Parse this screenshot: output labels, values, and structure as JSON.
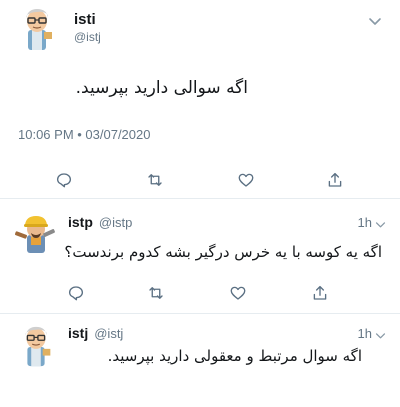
{
  "main_tweet": {
    "display_name": "isti",
    "handle": "@istj",
    "text": "اگه سوالی دارید بپرسید.",
    "timestamp": "10:06 PM • 03/07/2020",
    "avatar": "scientist-avatar",
    "actions": [
      "reply-icon",
      "retweet-icon",
      "like-icon",
      "share-icon"
    ]
  },
  "replies": [
    {
      "display_name": "istp",
      "handle": "@istp",
      "time_ago": "1h",
      "text": "اگه یه کوسه با یه خرس درگیر بشه کدوم برندست؟",
      "avatar": "builder-avatar"
    },
    {
      "display_name": "istj",
      "handle": "@istj",
      "time_ago": "1h",
      "text": "اگه سوال مرتبط و معقولی دارید بپرسید.",
      "avatar": "scientist-avatar"
    }
  ],
  "colors": {
    "text": "#14171a",
    "muted": "#657786",
    "icon": "#5b7083",
    "divider": "#e6ecf0"
  }
}
